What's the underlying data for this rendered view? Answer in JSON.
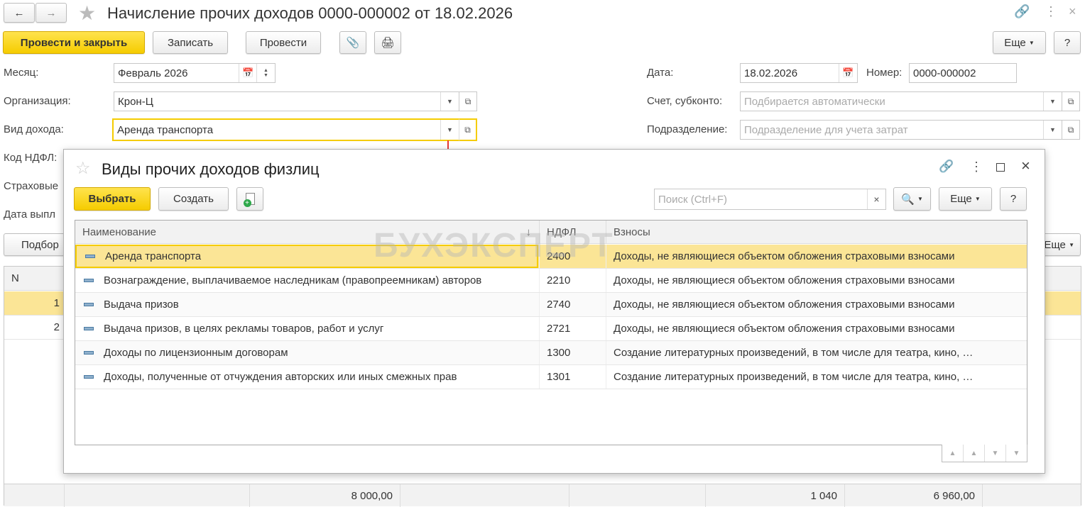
{
  "window": {
    "title": "Начисление прочих доходов 0000-000002 от 18.02.2026"
  },
  "toolbar": {
    "post_close": "Провести и закрыть",
    "save": "Записать",
    "post": "Провести",
    "more": "Еще",
    "help": "?"
  },
  "form": {
    "month_label": "Месяц:",
    "month_value": "Февраль 2026",
    "org_label": "Организация:",
    "org_value": "Крон-Ц",
    "income_label": "Вид дохода:",
    "income_value": "Аренда транспорта",
    "ndfl_label": "Код НДФЛ:",
    "insurance_label": "Страховые",
    "paydate_label": "Дата выпл",
    "date_label": "Дата:",
    "date_value": "18.02.2026",
    "number_label": "Номер:",
    "number_value": "0000-000002",
    "account_label": "Счет, субконто:",
    "account_placeholder": "Подбирается автоматически",
    "dept_label": "Подразделение:",
    "dept_placeholder": "Подразделение для учета затрат"
  },
  "table_toolbar": {
    "pick": "Подбор",
    "more": "Еще"
  },
  "main_table": {
    "col_n": "N",
    "rows": [
      "1",
      "2"
    ],
    "totals": [
      "8 000,00",
      "1 040",
      "6 960,00"
    ]
  },
  "dialog": {
    "title": "Виды прочих доходов физлиц",
    "select": "Выбрать",
    "create": "Создать",
    "search_placeholder": "Поиск (Ctrl+F)",
    "more": "Еще",
    "help": "?",
    "columns": [
      "Наименование",
      "НДФЛ",
      "Взносы"
    ],
    "rows": [
      {
        "name": "Аренда транспорта",
        "ndfl": "2400",
        "contrib": "Доходы, не являющиеся объектом обложения страховыми взносами"
      },
      {
        "name": "Вознаграждение, выплачиваемое наследникам (правопреемникам) авторов",
        "ndfl": "2210",
        "contrib": "Доходы, не являющиеся объектом обложения страховыми взносами"
      },
      {
        "name": "Выдача призов",
        "ndfl": "2740",
        "contrib": "Доходы, не являющиеся объектом обложения страховыми взносами"
      },
      {
        "name": "Выдача призов, в целях рекламы товаров, работ и услуг",
        "ndfl": "2721",
        "contrib": "Доходы, не являющиеся объектом обложения страховыми взносами"
      },
      {
        "name": "Доходы по лицензионным договорам",
        "ndfl": "1300",
        "contrib": "Создание литературных произведений, в том числе для театра, кино, …"
      },
      {
        "name": "Доходы, полученные от отчуждения авторских или иных смежных прав",
        "ndfl": "1301",
        "contrib": "Создание литературных произведений, в том числе для театра, кино, …"
      }
    ]
  },
  "watermark": "БУХЭКСПЕРТ",
  "colors": {
    "accent": "#f5cc00",
    "selected_row": "#fbe596",
    "arrow": "#e53935"
  }
}
